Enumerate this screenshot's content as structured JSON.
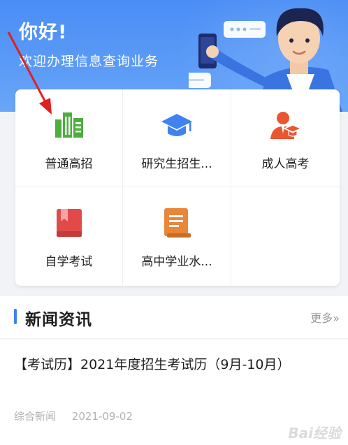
{
  "banner": {
    "greeting": "你好!",
    "welcome": "欢迎办理信息查询业务"
  },
  "services": [
    {
      "label": "普通高招",
      "icon": "building-icon",
      "color": "#4dae3e"
    },
    {
      "label": "研究生招生...",
      "icon": "graduation-cap-icon",
      "color": "#3f82f0"
    },
    {
      "label": "成人高考",
      "icon": "adult-graduate-icon",
      "color": "#e8572f"
    },
    {
      "label": "自学考试",
      "icon": "book-icon",
      "color": "#e24a4a"
    },
    {
      "label": "高中学业水...",
      "icon": "document-icon",
      "color": "#e8873a"
    }
  ],
  "news": {
    "title": "新闻资讯",
    "more": "更多»",
    "items": [
      {
        "title": "【考试历】2021年度招生考试历（9月-10月）",
        "category": "综合新闻",
        "date": "2021-09-02"
      }
    ]
  },
  "watermark": "Bai经验",
  "colors": {
    "banner": "#4a8df5",
    "accent": "#3f82f0",
    "arrow": "#e02020"
  }
}
